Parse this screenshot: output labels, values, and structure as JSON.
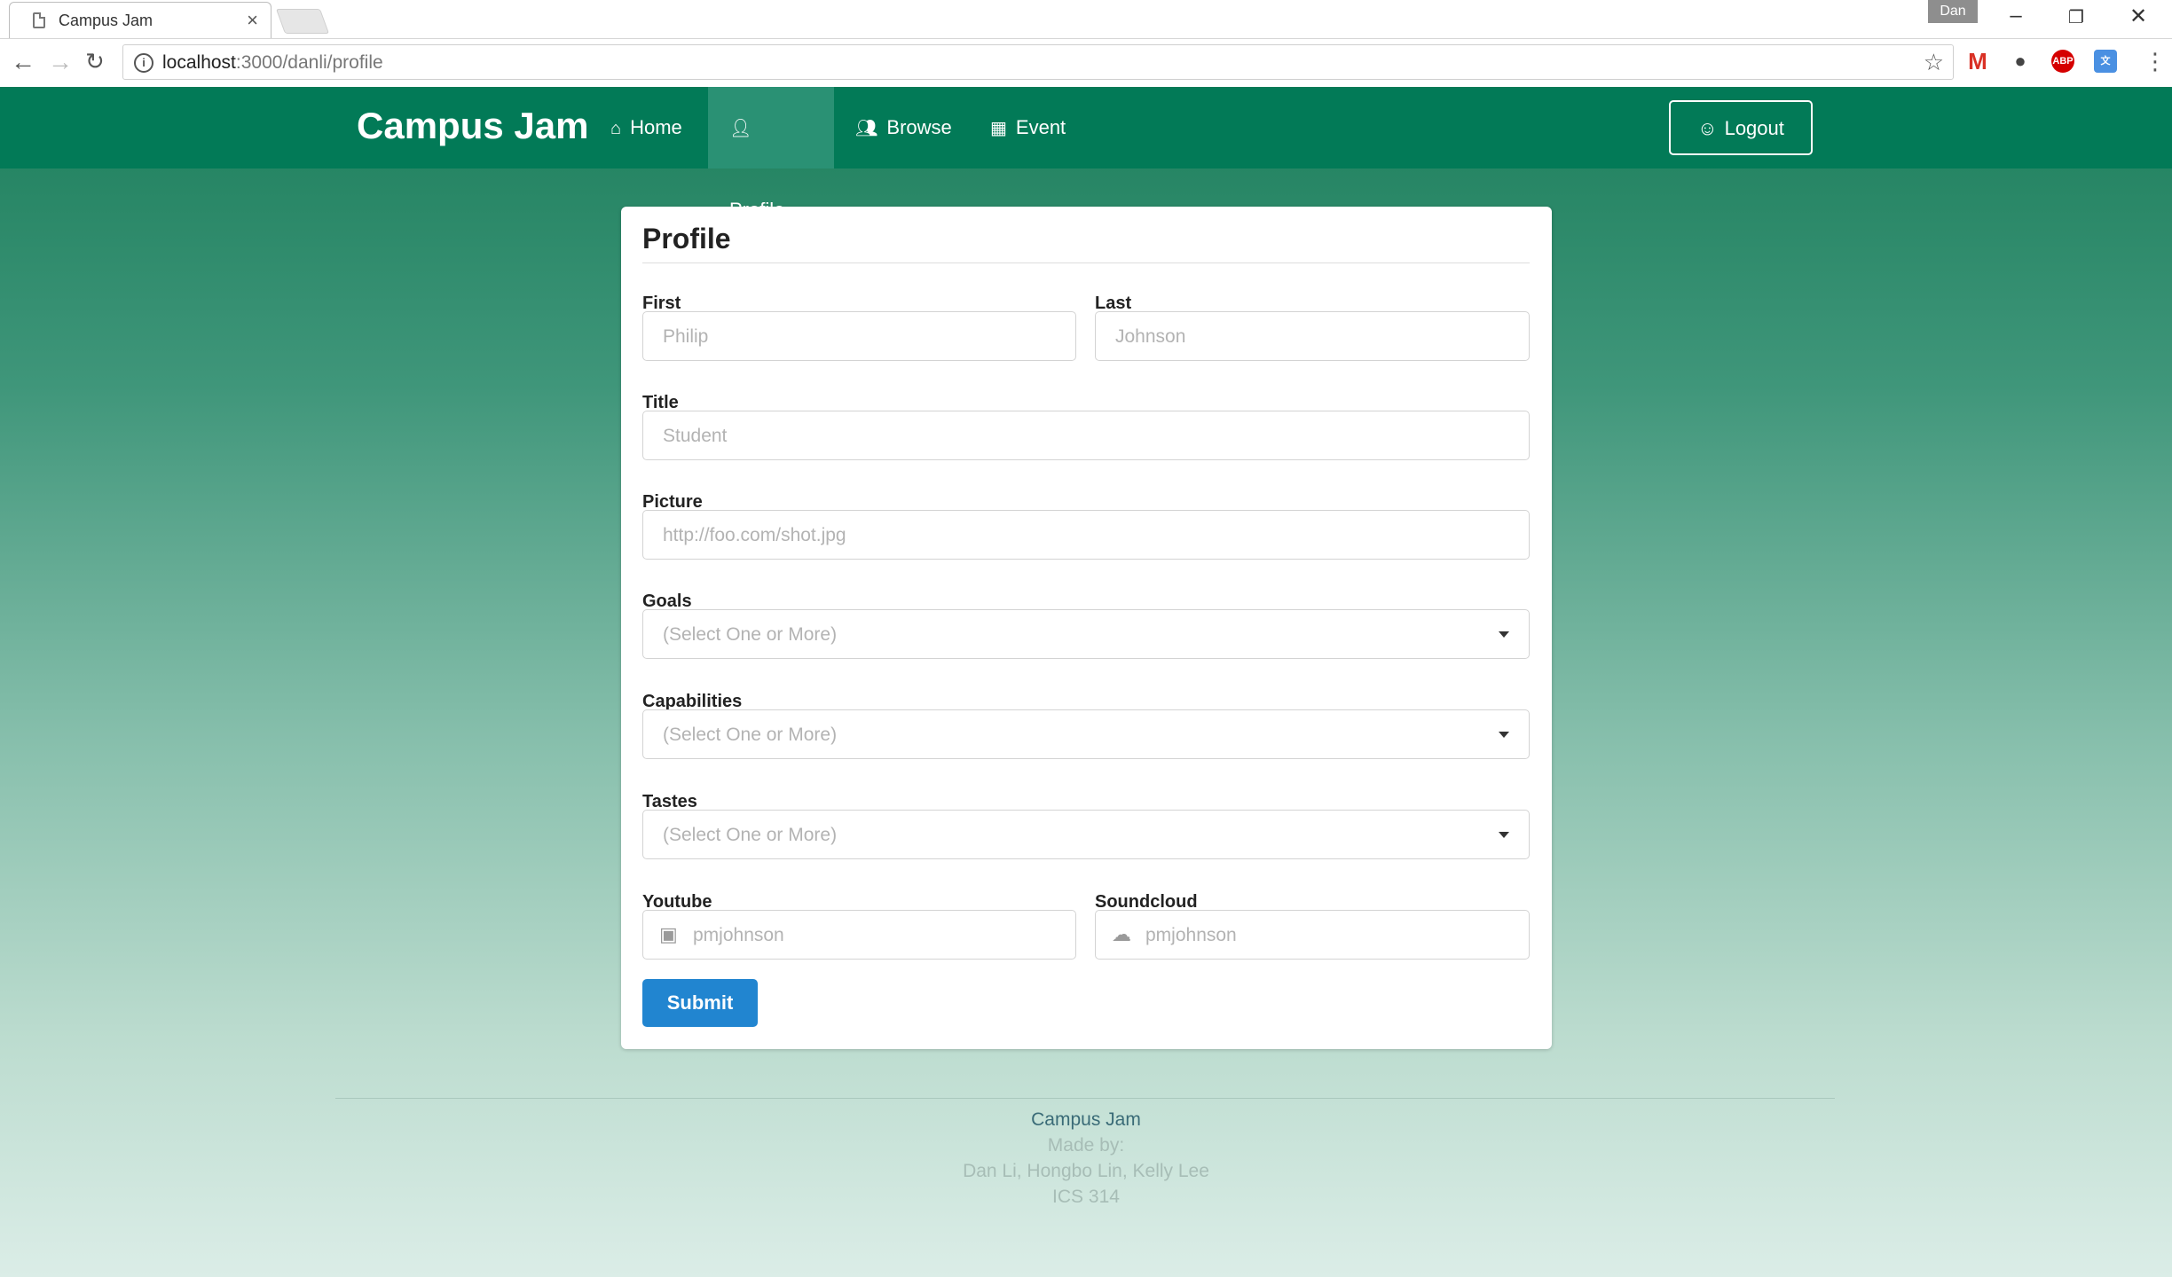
{
  "browser": {
    "tab_title": "Campus Jam",
    "tab_close": "×",
    "profile_name": "Dan",
    "url_host": "localhost",
    "url_rest": ":3000/danli/profile",
    "ext_abp": "ABP",
    "menu": "⋮"
  },
  "navbar": {
    "brand": "Campus Jam",
    "items": [
      {
        "label": "Home",
        "icon": "home-icon"
      },
      {
        "label": "Profile",
        "icon": "user-icon"
      },
      {
        "label": "Browse",
        "icon": "users-icon"
      },
      {
        "label": "Event",
        "icon": "calendar-icon"
      }
    ],
    "active": "Profile",
    "logout_label": "Logout"
  },
  "form": {
    "title": "Profile",
    "first_label": "First",
    "first_placeholder": "Philip",
    "last_label": "Last",
    "last_placeholder": "Johnson",
    "title_label": "Title",
    "title_placeholder": "Student",
    "picture_label": "Picture",
    "picture_placeholder": "http://foo.com/shot.jpg",
    "goals_label": "Goals",
    "goals_placeholder": "(Select One or More)",
    "capabilities_label": "Capabilities",
    "capabilities_placeholder": "(Select One or More)",
    "tastes_label": "Tastes",
    "tastes_placeholder": "(Select One or More)",
    "youtube_label": "Youtube",
    "youtube_placeholder": "pmjohnson",
    "soundcloud_label": "Soundcloud",
    "soundcloud_placeholder": "pmjohnson",
    "submit_label": "Submit"
  },
  "footer": {
    "app_name": "Campus Jam",
    "made_by": "Made by:",
    "authors": "Dan Li, Hongbo Lin, Kelly Lee",
    "course": "ICS 314"
  },
  "colors": {
    "navbar": "#027a57",
    "nav_active": "#2a9174",
    "submit": "#2185d0"
  }
}
